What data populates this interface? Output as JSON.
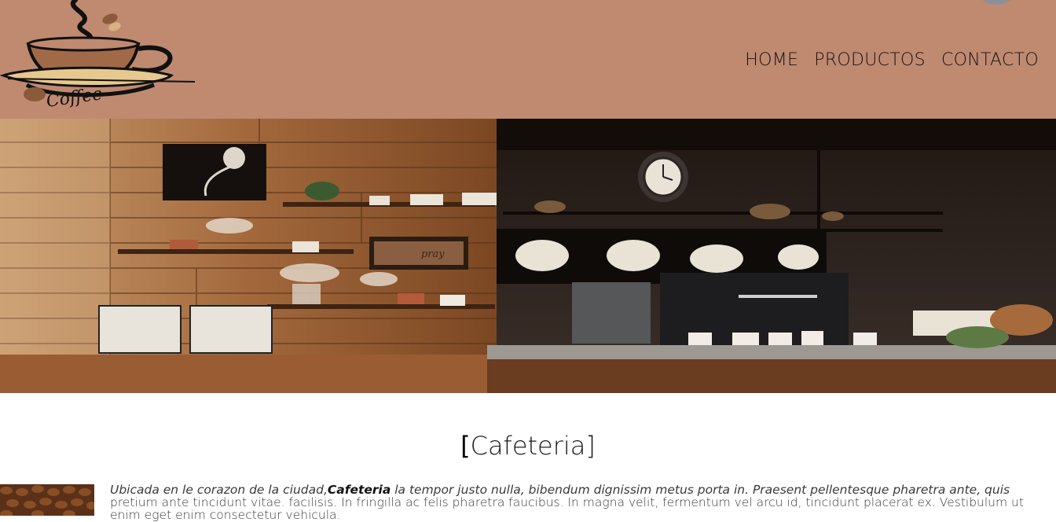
{
  "header": {
    "logo_text": "Coffee",
    "nav": [
      {
        "label": "HOME"
      },
      {
        "label": "PRODUCTOS"
      },
      {
        "label": "CONTACTO"
      }
    ]
  },
  "hero": {
    "plate_text": "pray",
    "clock_icon": "clock-icon"
  },
  "main": {
    "title_open": "[",
    "title_text": "Cafeteria",
    "title_close": "]",
    "intro_before": "Ubicada en le corazon de la ciudad,",
    "intro_brand": "Cafeteria",
    "intro_after": " la tempor justo nulla, bibendum dignissim metus porta in. Praesent pellentesque pharetra ante, quis",
    "body_text": "pretium ante tincidunt vitae. facilisis. In fringilla ac felis pharetra faucibus. In magna velit, fermentum vel arcu id, tincidunt placerat ex. Vestibulum ut enim eget enim consectetur vehicula."
  },
  "colors": {
    "header_bg": "#c08a70",
    "accent_dark": "#1a1210"
  }
}
